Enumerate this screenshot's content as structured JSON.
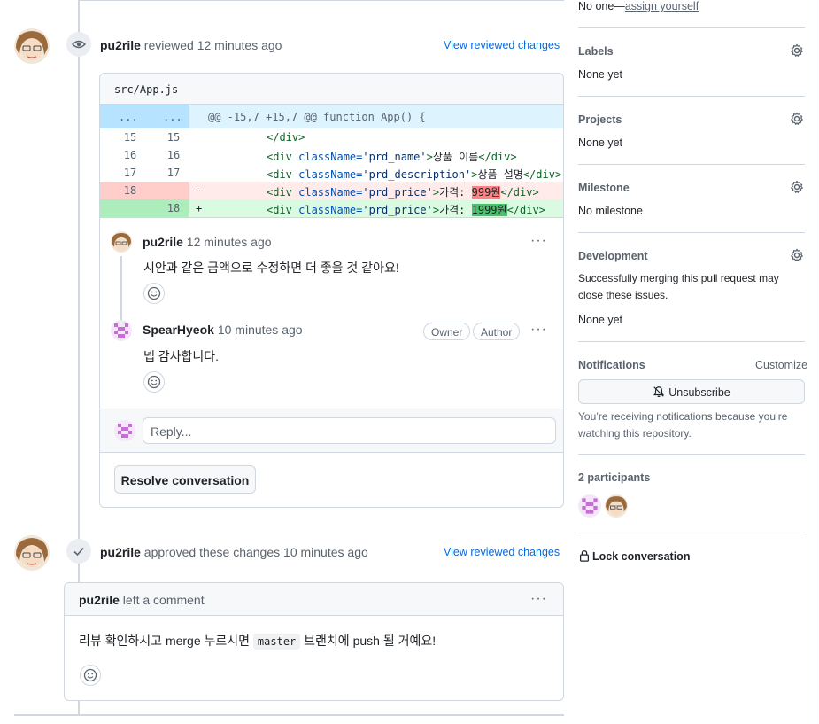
{
  "timeline": {
    "review_event": {
      "author": "pu2rile",
      "action": "reviewed",
      "time": "12 minutes ago",
      "view_link": "View reviewed changes"
    },
    "diff": {
      "file": "src/App.js",
      "hunk_left": "...",
      "hunk_right": "...",
      "hunk_header": "@@ -15,7 +15,7 @@ function App() {",
      "lines": [
        {
          "old": "15",
          "new": "15",
          "sign": "",
          "indent": "        ",
          "html_parts": [
            "</div>"
          ]
        },
        {
          "old": "16",
          "new": "16",
          "sign": "",
          "open_tag": "<div ",
          "attr": "className=",
          "attr_val": "'prd_name'",
          "close": ">",
          "text": "상품 이름",
          "end_tag": "</div>"
        },
        {
          "old": "17",
          "new": "17",
          "sign": "",
          "open_tag": "<div ",
          "attr": "className=",
          "attr_val": "'prd_description'",
          "close": ">",
          "text": "상품 설명",
          "end_tag": "</div>"
        },
        {
          "old": "18",
          "new": "",
          "sign": "-",
          "open_tag": "<div ",
          "attr": "className=",
          "attr_val": "'prd_price'",
          "close": ">",
          "text_prefix": "가격: ",
          "changed": "999원",
          "end_tag": "</div>"
        },
        {
          "old": "",
          "new": "18",
          "sign": "+",
          "open_tag": "<div ",
          "attr": "className=",
          "attr_val": "'prd_price'",
          "close": ">",
          "text_prefix": "가격: ",
          "changed": "1999원",
          "end_tag": "</div>"
        }
      ]
    },
    "thread": {
      "comments": [
        {
          "author": "pu2rile",
          "time": "12 minutes ago",
          "body": "시안과 같은 금액으로 수정하면 더 좋을 것 같아요!",
          "menu": "···"
        },
        {
          "author": "SpearHyeok",
          "time": "10 minutes ago",
          "body": "넵 감사합니다.",
          "badges": [
            "Owner",
            "Author"
          ],
          "menu": "···"
        }
      ],
      "reply_placeholder": "Reply...",
      "resolve_label": "Resolve conversation"
    },
    "approve_event": {
      "author": "pu2rile",
      "action": "approved these changes",
      "time": "10 minutes ago",
      "view_link": "View reviewed changes"
    },
    "approve_comment": {
      "author": "pu2rile",
      "action": "left a comment",
      "menu": "···",
      "body_before": "리뷰 확인하시고 merge 누르시면 ",
      "code": "master",
      "body_after": " 브랜치에 push 될 거예요!"
    }
  },
  "sidebar": {
    "assignees": {
      "prefix": "No one—",
      "link": "assign yourself"
    },
    "labels": {
      "title": "Labels",
      "value": "None yet"
    },
    "projects": {
      "title": "Projects",
      "value": "None yet"
    },
    "milestone": {
      "title": "Milestone",
      "value": "No milestone"
    },
    "development": {
      "title": "Development",
      "note": "Successfully merging this pull request may close these issues.",
      "value": "None yet"
    },
    "notifications": {
      "title": "Notifications",
      "customize": "Customize",
      "button": "Unsubscribe",
      "note": "You’re receiving notifications because you’re watching this repository."
    },
    "participants": {
      "title": "2 participants"
    },
    "lock": {
      "label": "Lock conversation"
    }
  },
  "colors": {
    "link": "#0969da",
    "del": "#ffebe9",
    "add": "#dafbe1",
    "hunk": "#ddf4ff"
  }
}
